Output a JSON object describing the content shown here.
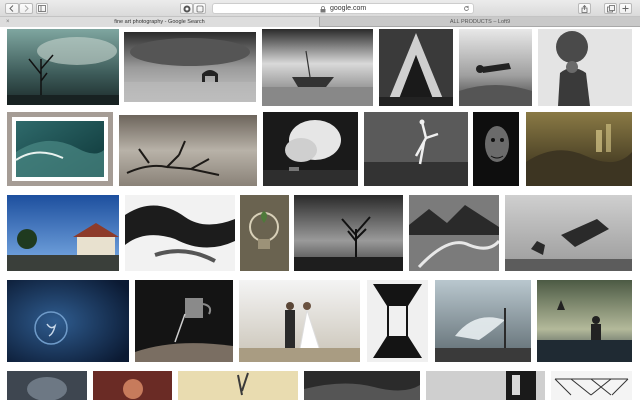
{
  "browser": {
    "address": {
      "url": "google.com"
    },
    "tabs": [
      {
        "label": "fine art photography - Google Search",
        "active": true
      },
      {
        "label": "ALL PRODUCTS – Loft9",
        "active": false
      }
    ],
    "toolbar_icons": [
      "back-icon",
      "forward-icon",
      "sidebar-icon",
      "privacy-icon",
      "lock-icon",
      "reload-icon",
      "share-icon",
      "new-tab-icon",
      "tabs-overview-icon"
    ]
  },
  "results": {
    "rows": [
      [
        "lone tree under cloudy sky",
        "horse in misty water",
        "shipwreck on calm sea",
        "tower arch monument",
        "floating figure over landscape",
        "woman with cloud head"
      ],
      [
        "ocean wave framed print",
        "driftwood branch on beach",
        "cumulus cloud over field",
        "dancer leaping on beach",
        "face in shadow",
        "surreal city collage"
      ],
      [
        "house under blue sky",
        "clouds and smoke abstract",
        "light bulb with plant",
        "tree under dark sky",
        "winding river mountains",
        "animal silhouettes leaping"
      ],
      [
        "figure in deep water",
        "teapot pouring on hand",
        "wedding couple on beach",
        "mirrored silhouette",
        "woman in flowing dress on chair",
        "boy watching boat at sea"
      ],
      [
        "dark sky portrait",
        "red toned figure",
        "figure on sand dunes",
        "rocky coastline",
        "dark interior window",
        "steel structure"
      ]
    ]
  }
}
